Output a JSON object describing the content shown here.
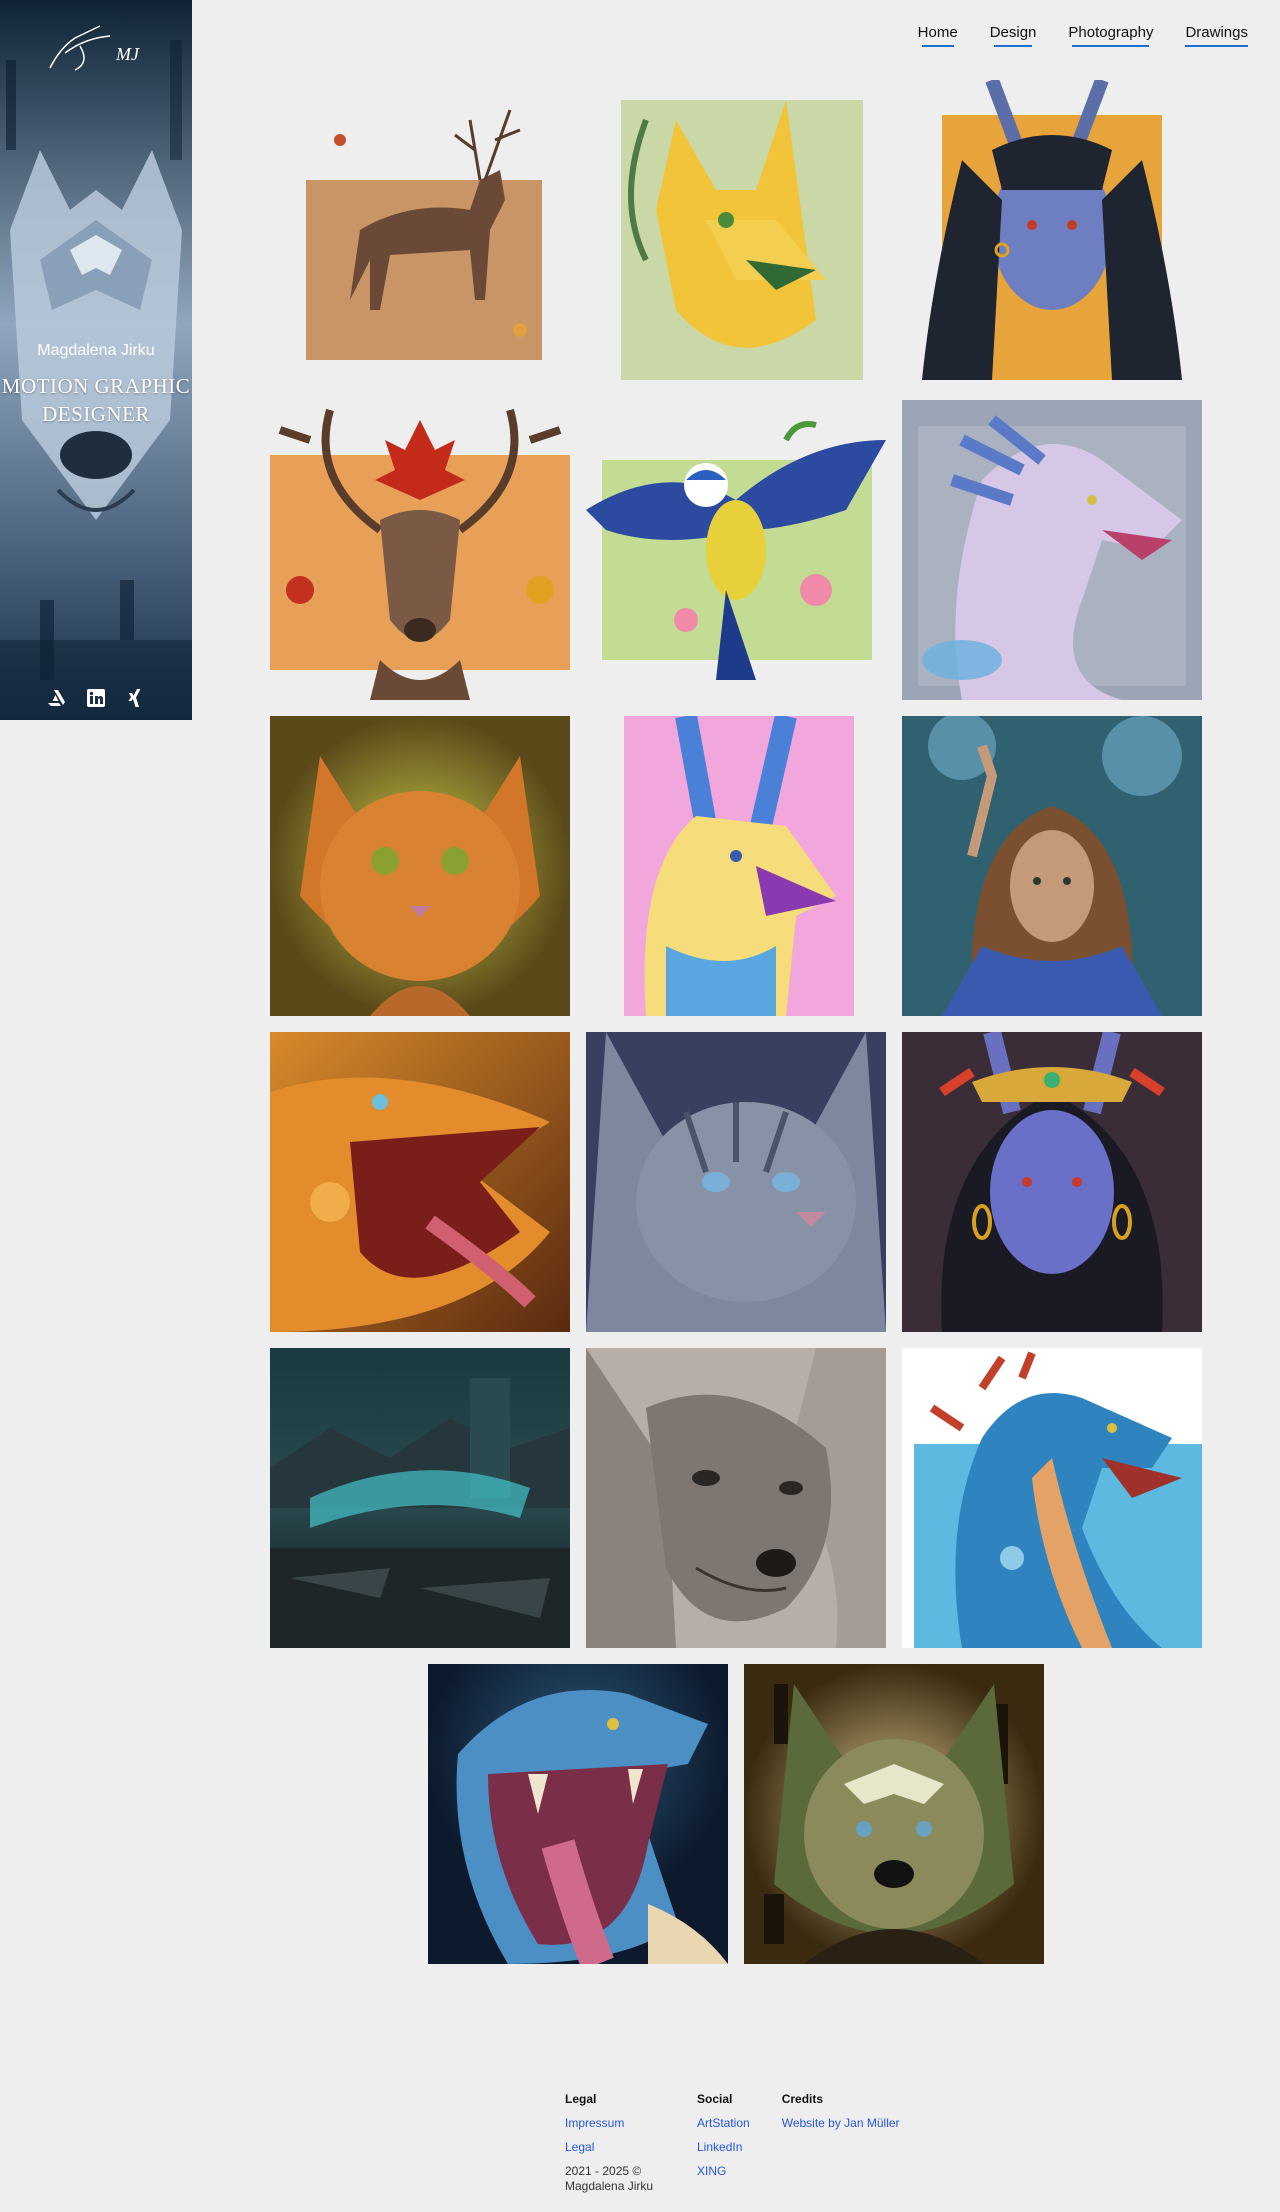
{
  "sidebar": {
    "name": "Magdalena Jirku",
    "title_line1": "MOTION GRAPHIC",
    "title_line2": "DESIGNER",
    "logo_initials": "MJ",
    "socials": [
      {
        "icon": "artstation-icon",
        "label": "ArtStation"
      },
      {
        "icon": "linkedin-icon",
        "label": "LinkedIn"
      },
      {
        "icon": "xing-icon",
        "label": "XING"
      }
    ]
  },
  "nav": {
    "items": [
      {
        "label": "Home",
        "active": false
      },
      {
        "label": "Design",
        "active": false
      },
      {
        "label": "Photography",
        "active": false
      },
      {
        "label": "Drawings",
        "active": true
      }
    ]
  },
  "gallery": {
    "items": [
      {
        "name": "deer-autumn-leaves",
        "bg": "#c99466"
      },
      {
        "name": "yellow-fox-creature",
        "bg": "#c9d8a6"
      },
      {
        "name": "blue-horned-elf",
        "bg": "#e6a43a"
      },
      {
        "name": "stag-maple-leaf",
        "bg": "#e8a058"
      },
      {
        "name": "blue-tit-bird",
        "bg": "#c2dc93"
      },
      {
        "name": "lilac-dragon",
        "bg": "#9ba5b6"
      },
      {
        "name": "orange-cat",
        "bg": "#b9b53b"
      },
      {
        "name": "yellow-blue-creature",
        "bg": "#f2a7dc"
      },
      {
        "name": "water-girl",
        "bg": "#2f6170"
      },
      {
        "name": "fire-dragon",
        "bg": "#d27a2a"
      },
      {
        "name": "grey-tabby-cat",
        "bg": "#37415f"
      },
      {
        "name": "purple-elf-crown",
        "bg": "#3a2d38"
      },
      {
        "name": "dark-landscape-deer",
        "bg": "#1f3036"
      },
      {
        "name": "pencil-wolf",
        "bg": "#9d958e"
      },
      {
        "name": "blue-sea-dragon",
        "bg": "#5db9df"
      },
      {
        "name": "blue-dragon-roar",
        "bg": "#1a3350"
      },
      {
        "name": "dark-wolf",
        "bg": "#8a7340"
      }
    ]
  },
  "footer": {
    "legal_heading": "Legal",
    "legal_links": [
      "Impressum",
      "Legal"
    ],
    "copyright": "2021 - 2025 © Magdalena Jirku",
    "social_heading": "Social",
    "social_links": [
      "ArtStation",
      "LinkedIn",
      "XING"
    ],
    "credits_heading": "Credits",
    "credits_link": "Website by Jan Müller"
  }
}
